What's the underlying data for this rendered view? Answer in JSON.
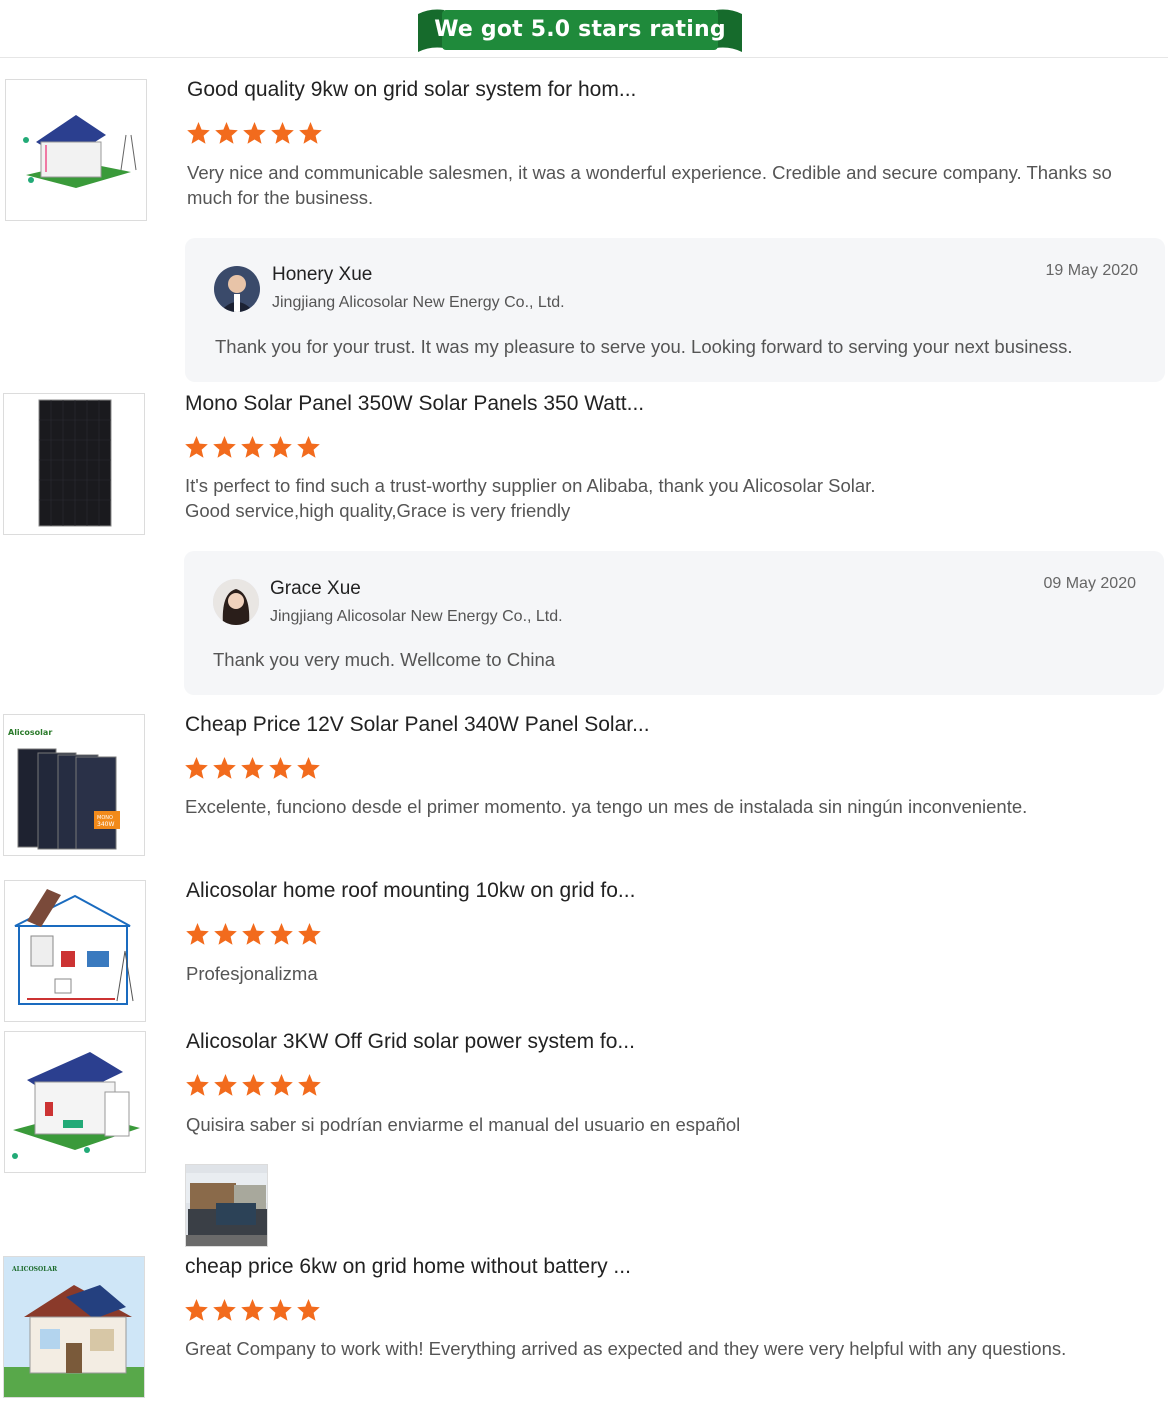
{
  "banner": {
    "text": "We got 5.0 stars rating",
    "color": "#1f8a3b"
  },
  "star_color": "#f26b1d",
  "reviews": [
    {
      "title": "Good quality 9kw on grid solar system for hom...",
      "rating": 5,
      "text": "Very nice and communicable salesmen, it was a wonderful experience. Credible and secure company. Thanks so much for the business.",
      "thumb_icon": "grid-solar-house-icon",
      "reply": {
        "name": "Honery Xue",
        "company": "Jingjiang Alicosolar New Energy Co., Ltd.",
        "date": "19 May 2020",
        "text": "Thank you for your trust. It was my pleasure to serve you. Looking forward to serving your next business."
      }
    },
    {
      "title": "Mono Solar Panel 350W Solar Panels 350 Watt...",
      "rating": 5,
      "text_lines": [
        "It's perfect to find such a trust-worthy supplier on Alibaba, thank you Alicosolar Solar.",
        "Good service,high quality,Grace is very friendly"
      ],
      "thumb_icon": "mono-solar-panel-icon",
      "reply": {
        "name": "Grace Xue",
        "company": "Jingjiang Alicosolar New Energy Co., Ltd.",
        "date": "09 May 2020",
        "text": "Thank you very much. Wellcome to  China"
      }
    },
    {
      "title": "Cheap Price 12V Solar Panel 340W Panel Solar...",
      "rating": 5,
      "text": "Excelente, funciono desde el primer momento. ya tengo un mes de instalada sin ningún inconveniente.",
      "thumb_icon": "solar-panels-stack-icon",
      "thumb_brand": "Alicosolar",
      "thumb_badge": [
        "MONO",
        "340W"
      ]
    },
    {
      "title": "Alicosolar home roof mounting 10kw on grid fo...",
      "rating": 5,
      "text": "Profesjonalizma",
      "thumb_icon": "roof-mounting-diagram-icon"
    },
    {
      "title": "Alicosolar 3KW Off Grid solar power system fo...",
      "rating": 5,
      "text": "Quisira saber si podrían enviarme el manual del usuario en español",
      "thumb_icon": "off-grid-house-icon",
      "photo_icon": "customer-photo-icon"
    },
    {
      "title": "cheap price 6kw on grid home without battery ...",
      "rating": 5,
      "text": "Great Company to work with! Everything arrived as expected and they were very helpful with any questions.",
      "thumb_icon": "on-grid-home-icon",
      "thumb_brand": "ALICOSOLAR"
    }
  ]
}
